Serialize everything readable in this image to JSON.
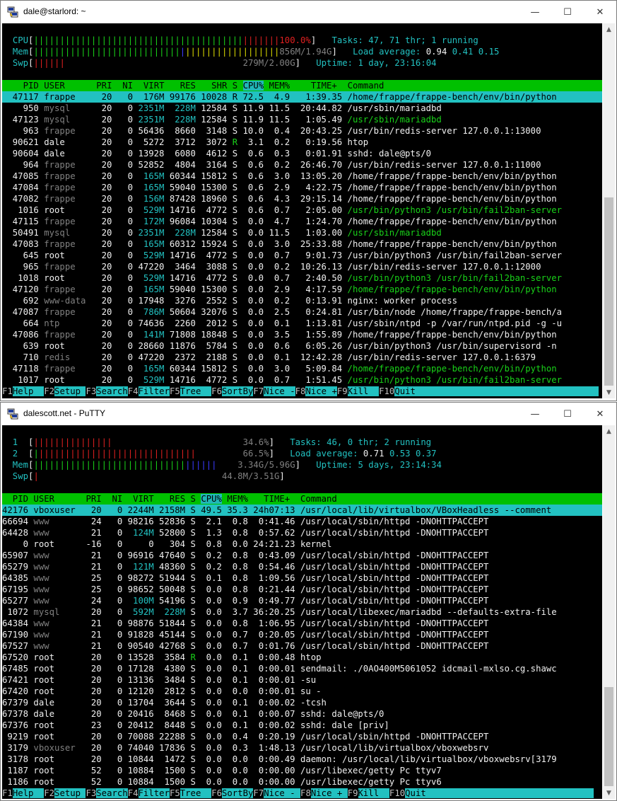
{
  "window1": {
    "title": "dale@starlord: ~",
    "meters": {
      "cpu_label": "CPU",
      "cpu_green": "||||||||||||||||||||||||||||||||||||||||",
      "cpu_red": "|||||||",
      "cpu_value": "100.0%",
      "mem_label": "Mem",
      "mem_green": "||||||||||||||||||||||||||||",
      "mem_blue": "|",
      "mem_yellow": "||||||||||||||||||",
      "mem_value": "856M/1.94G",
      "swp_label": "Swp",
      "swp_red": "||||||",
      "swp_value": "279M/2.00G",
      "tasks_label": "Tasks: ",
      "tasks_value": "47, 71 thr; 1 running",
      "load_label": "Load average: ",
      "load_1": "0.94",
      "load_5": "0.41",
      "load_15": "0.15",
      "uptime_label": "Uptime: ",
      "uptime_value": "1 day, 23:16:04"
    },
    "header": {
      "left": "    PID USER      PRI  NI  VIRT   RES   SHR S ",
      "sorted": "CPU%",
      "right": " MEM%    TIME+  Command"
    },
    "rows": [
      {
        "pid": "47117",
        "user": "frappe",
        "pri": "20",
        "ni": "0",
        "virt": "176M",
        "res": "99176",
        "shr": "10028",
        "s": "R",
        "cpu": "72.5",
        "mem": "4.9",
        "time": "1:39.35",
        "cmd": "/home/frappe/frappe-bench/env/bin/python",
        "selected": true
      },
      {
        "pid": "950",
        "user": "mysql",
        "pri": "20",
        "ni": "0",
        "virt": "2351M",
        "res": "228M",
        "shr": "12584",
        "s": "S",
        "cpu": "11.9",
        "mem": "11.5",
        "time": "20:44.82",
        "cmd": "/usr/sbin/mariadbd"
      },
      {
        "pid": "47123",
        "user": "mysql",
        "pri": "20",
        "ni": "0",
        "virt": "2351M",
        "res": "228M",
        "shr": "12584",
        "s": "S",
        "cpu": "11.9",
        "mem": "11.5",
        "time": "1:05.49",
        "cmd": "/usr/sbin/mariadbd",
        "thread": true
      },
      {
        "pid": "963",
        "user": "frappe",
        "pri": "20",
        "ni": "0",
        "virt": "56436",
        "res": "8660",
        "shr": "3148",
        "s": "S",
        "cpu": "10.0",
        "mem": "0.4",
        "time": "20:43.25",
        "cmd": "/usr/bin/redis-server 127.0.0.1:13000"
      },
      {
        "pid": "90621",
        "user": "dale",
        "pri": "20",
        "ni": "0",
        "virt": "5272",
        "res": "3712",
        "shr": "3072",
        "s": "R",
        "cpu": "3.1",
        "mem": "0.2",
        "time": "0:19.56",
        "cmd": "htop"
      },
      {
        "pid": "90604",
        "user": "dale",
        "pri": "20",
        "ni": "0",
        "virt": "13928",
        "res": "6080",
        "shr": "4612",
        "s": "S",
        "cpu": "0.6",
        "mem": "0.3",
        "time": "0:01.91",
        "cmd": "sshd: dale@pts/0"
      },
      {
        "pid": "964",
        "user": "frappe",
        "pri": "20",
        "ni": "0",
        "virt": "52852",
        "res": "4804",
        "shr": "3164",
        "s": "S",
        "cpu": "0.6",
        "mem": "0.2",
        "time": "26:46.70",
        "cmd": "/usr/bin/redis-server 127.0.0.1:11000"
      },
      {
        "pid": "47085",
        "user": "frappe",
        "pri": "20",
        "ni": "0",
        "virt": "165M",
        "res": "60344",
        "shr": "15812",
        "s": "S",
        "cpu": "0.6",
        "mem": "3.0",
        "time": "13:05.20",
        "cmd": "/home/frappe/frappe-bench/env/bin/python"
      },
      {
        "pid": "47084",
        "user": "frappe",
        "pri": "20",
        "ni": "0",
        "virt": "165M",
        "res": "59040",
        "shr": "15300",
        "s": "S",
        "cpu": "0.6",
        "mem": "2.9",
        "time": "4:22.75",
        "cmd": "/home/frappe/frappe-bench/env/bin/python"
      },
      {
        "pid": "47082",
        "user": "frappe",
        "pri": "20",
        "ni": "0",
        "virt": "156M",
        "res": "87428",
        "shr": "18960",
        "s": "S",
        "cpu": "0.6",
        "mem": "4.3",
        "time": "29:15.14",
        "cmd": "/home/frappe/frappe-bench/env/bin/python"
      },
      {
        "pid": "1016",
        "user": "root",
        "pri": "20",
        "ni": "0",
        "virt": "529M",
        "res": "14716",
        "shr": "4772",
        "s": "S",
        "cpu": "0.6",
        "mem": "0.7",
        "time": "2:05.00",
        "cmd": "/usr/bin/python3 /usr/bin/fail2ban-server",
        "thread": true
      },
      {
        "pid": "47115",
        "user": "frappe",
        "pri": "20",
        "ni": "0",
        "virt": "172M",
        "res": "96084",
        "shr": "10304",
        "s": "S",
        "cpu": "0.0",
        "mem": "4.7",
        "time": "1:24.70",
        "cmd": "/home/frappe/frappe-bench/env/bin/python"
      },
      {
        "pid": "50491",
        "user": "mysql",
        "pri": "20",
        "ni": "0",
        "virt": "2351M",
        "res": "228M",
        "shr": "12584",
        "s": "S",
        "cpu": "0.0",
        "mem": "11.5",
        "time": "1:03.00",
        "cmd": "/usr/sbin/mariadbd",
        "thread": true
      },
      {
        "pid": "47083",
        "user": "frappe",
        "pri": "20",
        "ni": "0",
        "virt": "165M",
        "res": "60312",
        "shr": "15924",
        "s": "S",
        "cpu": "0.0",
        "mem": "3.0",
        "time": "25:33.88",
        "cmd": "/home/frappe/frappe-bench/env/bin/python"
      },
      {
        "pid": "645",
        "user": "root",
        "pri": "20",
        "ni": "0",
        "virt": "529M",
        "res": "14716",
        "shr": "4772",
        "s": "S",
        "cpu": "0.0",
        "mem": "0.7",
        "time": "9:01.73",
        "cmd": "/usr/bin/python3 /usr/bin/fail2ban-server"
      },
      {
        "pid": "965",
        "user": "frappe",
        "pri": "20",
        "ni": "0",
        "virt": "47220",
        "res": "3464",
        "shr": "3088",
        "s": "S",
        "cpu": "0.0",
        "mem": "0.2",
        "time": "10:26.13",
        "cmd": "/usr/bin/redis-server 127.0.0.1:12000"
      },
      {
        "pid": "1018",
        "user": "root",
        "pri": "20",
        "ni": "0",
        "virt": "529M",
        "res": "14716",
        "shr": "4772",
        "s": "S",
        "cpu": "0.0",
        "mem": "0.7",
        "time": "2:40.50",
        "cmd": "/usr/bin/python3 /usr/bin/fail2ban-server",
        "thread": true
      },
      {
        "pid": "47120",
        "user": "frappe",
        "pri": "20",
        "ni": "0",
        "virt": "165M",
        "res": "59040",
        "shr": "15300",
        "s": "S",
        "cpu": "0.0",
        "mem": "2.9",
        "time": "4:17.59",
        "cmd": "/home/frappe/frappe-bench/env/bin/python",
        "thread": true
      },
      {
        "pid": "692",
        "user": "www-data",
        "pri": "20",
        "ni": "0",
        "virt": "17948",
        "res": "3276",
        "shr": "2552",
        "s": "S",
        "cpu": "0.0",
        "mem": "0.2",
        "time": "0:13.91",
        "cmd": "nginx: worker process"
      },
      {
        "pid": "47087",
        "user": "frappe",
        "pri": "20",
        "ni": "0",
        "virt": "786M",
        "res": "50604",
        "shr": "32076",
        "s": "S",
        "cpu": "0.0",
        "mem": "2.5",
        "time": "0:24.81",
        "cmd": "/usr/bin/node /home/frappe/frappe-bench/a"
      },
      {
        "pid": "664",
        "user": "ntp",
        "pri": "20",
        "ni": "0",
        "virt": "74636",
        "res": "2260",
        "shr": "2012",
        "s": "S",
        "cpu": "0.0",
        "mem": "0.1",
        "time": "1:13.81",
        "cmd": "/usr/sbin/ntpd -p /var/run/ntpd.pid -g -u"
      },
      {
        "pid": "47086",
        "user": "frappe",
        "pri": "20",
        "ni": "0",
        "virt": "141M",
        "res": "71808",
        "shr": "18848",
        "s": "S",
        "cpu": "0.0",
        "mem": "3.5",
        "time": "1:55.89",
        "cmd": "/home/frappe/frappe-bench/env/bin/python"
      },
      {
        "pid": "639",
        "user": "root",
        "pri": "20",
        "ni": "0",
        "virt": "28660",
        "res": "11876",
        "shr": "5784",
        "s": "S",
        "cpu": "0.0",
        "mem": "0.6",
        "time": "6:05.26",
        "cmd": "/usr/bin/python3 /usr/bin/supervisord -n"
      },
      {
        "pid": "710",
        "user": "redis",
        "pri": "20",
        "ni": "0",
        "virt": "47220",
        "res": "2372",
        "shr": "2188",
        "s": "S",
        "cpu": "0.0",
        "mem": "0.1",
        "time": "12:42.28",
        "cmd": "/usr/bin/redis-server 127.0.0.1:6379"
      },
      {
        "pid": "47118",
        "user": "frappe",
        "pri": "20",
        "ni": "0",
        "virt": "165M",
        "res": "60344",
        "shr": "15812",
        "s": "S",
        "cpu": "0.0",
        "mem": "3.0",
        "time": "5:09.84",
        "cmd": "/home/frappe/frappe-bench/env/bin/python",
        "thread": true
      },
      {
        "pid": "1017",
        "user": "root",
        "pri": "20",
        "ni": "0",
        "virt": "529M",
        "res": "14716",
        "shr": "4772",
        "s": "S",
        "cpu": "0.0",
        "mem": "0.7",
        "time": "1:51.45",
        "cmd": "/usr/bin/python3 /usr/bin/fail2ban-server",
        "thread": true
      }
    ],
    "fkeys": [
      {
        "key": "F1",
        "label": "Help  "
      },
      {
        "key": "F2",
        "label": "Setup "
      },
      {
        "key": "F3",
        "label": "Search"
      },
      {
        "key": "F4",
        "label": "Filter"
      },
      {
        "key": "F5",
        "label": "Tree  "
      },
      {
        "key": "F6",
        "label": "SortBy"
      },
      {
        "key": "F7",
        "label": "Nice -"
      },
      {
        "key": "F8",
        "label": "Nice +"
      },
      {
        "key": "F9",
        "label": "Kill  "
      },
      {
        "key": "F10",
        "label": "Quit                                   "
      }
    ]
  },
  "window2": {
    "title": "dalescott.net - PuTTY",
    "meters": {
      "cpu1_label": "  1  ",
      "cpu1_red": "|||||||||||||||",
      "cpu1_value": "34.6%",
      "cpu2_label": "  2  ",
      "cpu2_green": "|",
      "cpu2_red": "||||||||||||||||||||||||||||||",
      "cpu2_value": "66.5%",
      "mem_label": "  Mem",
      "mem_green": "|||||||||||||||||||||||||||||",
      "mem_blue": "||||||",
      "mem_value": "3.34G/5.96G",
      "swp_label": "  Swp",
      "swp_red": "|",
      "swp_value": "44.8M/3.51G",
      "tasks_label": "Tasks: ",
      "tasks_value": "46, 0 thr; 2 running",
      "load_label": "Load average: ",
      "load_1": "0.71",
      "load_5": "0.53",
      "load_15": "0.37",
      "uptime_label": "Uptime: ",
      "uptime_value": "5 days, 23:14:34"
    },
    "header": {
      "left": "  PID USER      PRI  NI  VIRT   RES S ",
      "sorted": "CPU%",
      "right": " MEM%   TIME+  Command"
    },
    "rows": [
      {
        "pid": "42176",
        "user": "vboxuser",
        "pri": "20",
        "ni": "0",
        "virt": "2244M",
        "res": "2158M",
        "s": "S",
        "cpu": "49.5",
        "mem": "35.3",
        "time": "24h07:13",
        "cmd": "/usr/local/lib/virtualbox/VBoxHeadless --comment",
        "selected": true
      },
      {
        "pid": "66694",
        "user": "www",
        "pri": "24",
        "ni": "0",
        "virt": "98216",
        "res": "52836",
        "s": "S",
        "cpu": "2.1",
        "mem": "0.8",
        "time": "0:41.46",
        "cmd": "/usr/local/sbin/httpd -DNOHTTPACCEPT"
      },
      {
        "pid": "64428",
        "user": "www",
        "pri": "21",
        "ni": "0",
        "virt": "124M",
        "res": "52800",
        "s": "S",
        "cpu": "1.3",
        "mem": "0.8",
        "time": "0:57.62",
        "cmd": "/usr/local/sbin/httpd -DNOHTTPACCEPT"
      },
      {
        "pid": "0",
        "user": "root",
        "pri": "-16",
        "ni": "0",
        "virt": "0",
        "res": "304",
        "s": "S",
        "cpu": "0.8",
        "mem": "0.0",
        "time": "24:21.23",
        "cmd": "kernel"
      },
      {
        "pid": "65907",
        "user": "www",
        "pri": "21",
        "ni": "0",
        "virt": "96916",
        "res": "47640",
        "s": "S",
        "cpu": "0.2",
        "mem": "0.8",
        "time": "0:43.09",
        "cmd": "/usr/local/sbin/httpd -DNOHTTPACCEPT"
      },
      {
        "pid": "65279",
        "user": "www",
        "pri": "21",
        "ni": "0",
        "virt": "121M",
        "res": "48360",
        "s": "S",
        "cpu": "0.2",
        "mem": "0.8",
        "time": "0:54.46",
        "cmd": "/usr/local/sbin/httpd -DNOHTTPACCEPT"
      },
      {
        "pid": "64385",
        "user": "www",
        "pri": "25",
        "ni": "0",
        "virt": "98272",
        "res": "51944",
        "s": "S",
        "cpu": "0.1",
        "mem": "0.8",
        "time": "1:09.56",
        "cmd": "/usr/local/sbin/httpd -DNOHTTPACCEPT"
      },
      {
        "pid": "67195",
        "user": "www",
        "pri": "25",
        "ni": "0",
        "virt": "98652",
        "res": "50048",
        "s": "S",
        "cpu": "0.0",
        "mem": "0.8",
        "time": "0:21.44",
        "cmd": "/usr/local/sbin/httpd -DNOHTTPACCEPT"
      },
      {
        "pid": "65277",
        "user": "www",
        "pri": "24",
        "ni": "0",
        "virt": "100M",
        "res": "54196",
        "s": "S",
        "cpu": "0.0",
        "mem": "0.9",
        "time": "0:49.77",
        "cmd": "/usr/local/sbin/httpd -DNOHTTPACCEPT"
      },
      {
        "pid": "1072",
        "user": "mysql",
        "pri": "20",
        "ni": "0",
        "virt": "592M",
        "res": "228M",
        "s": "S",
        "cpu": "0.0",
        "mem": "3.7",
        "time": "36:20.25",
        "cmd": "/usr/local/libexec/mariadbd --defaults-extra-file"
      },
      {
        "pid": "64384",
        "user": "www",
        "pri": "21",
        "ni": "0",
        "virt": "98876",
        "res": "51844",
        "s": "S",
        "cpu": "0.0",
        "mem": "0.8",
        "time": "1:06.95",
        "cmd": "/usr/local/sbin/httpd -DNOHTTPACCEPT"
      },
      {
        "pid": "67190",
        "user": "www",
        "pri": "21",
        "ni": "0",
        "virt": "91828",
        "res": "45144",
        "s": "S",
        "cpu": "0.0",
        "mem": "0.7",
        "time": "0:20.05",
        "cmd": "/usr/local/sbin/httpd -DNOHTTPACCEPT"
      },
      {
        "pid": "67527",
        "user": "www",
        "pri": "21",
        "ni": "0",
        "virt": "90540",
        "res": "42768",
        "s": "S",
        "cpu": "0.0",
        "mem": "0.7",
        "time": "0:01.76",
        "cmd": "/usr/local/sbin/httpd -DNOHTTPACCEPT"
      },
      {
        "pid": "67520",
        "user": "root",
        "pri": "20",
        "ni": "0",
        "virt": "13528",
        "res": "3584",
        "s": "R",
        "cpu": "0.0",
        "mem": "0.1",
        "time": "0:00.48",
        "cmd": "htop"
      },
      {
        "pid": "67485",
        "user": "root",
        "pri": "20",
        "ni": "0",
        "virt": "17128",
        "res": "4380",
        "s": "S",
        "cpu": "0.0",
        "mem": "0.1",
        "time": "0:00.01",
        "cmd": "sendmail: ./0AO400M5061052 idcmail-mxlso.cg.shawc"
      },
      {
        "pid": "67421",
        "user": "root",
        "pri": "20",
        "ni": "0",
        "virt": "13136",
        "res": "3484",
        "s": "S",
        "cpu": "0.0",
        "mem": "0.1",
        "time": "0:00.01",
        "cmd": "-su"
      },
      {
        "pid": "67420",
        "user": "root",
        "pri": "20",
        "ni": "0",
        "virt": "12120",
        "res": "2812",
        "s": "S",
        "cpu": "0.0",
        "mem": "0.0",
        "time": "0:00.01",
        "cmd": "su -"
      },
      {
        "pid": "67379",
        "user": "dale",
        "pri": "20",
        "ni": "0",
        "virt": "13704",
        "res": "3644",
        "s": "S",
        "cpu": "0.0",
        "mem": "0.1",
        "time": "0:00.02",
        "cmd": "-tcsh"
      },
      {
        "pid": "67378",
        "user": "dale",
        "pri": "20",
        "ni": "0",
        "virt": "20416",
        "res": "8468",
        "s": "S",
        "cpu": "0.0",
        "mem": "0.1",
        "time": "0:00.07",
        "cmd": "sshd: dale@pts/0"
      },
      {
        "pid": "67376",
        "user": "root",
        "pri": "23",
        "ni": "0",
        "virt": "20412",
        "res": "8448",
        "s": "S",
        "cpu": "0.0",
        "mem": "0.1",
        "time": "0:00.02",
        "cmd": "sshd: dale [priv]"
      },
      {
        "pid": "9219",
        "user": "root",
        "pri": "20",
        "ni": "0",
        "virt": "70088",
        "res": "22288",
        "s": "S",
        "cpu": "0.0",
        "mem": "0.4",
        "time": "0:20.19",
        "cmd": "/usr/local/sbin/httpd -DNOHTTPACCEPT"
      },
      {
        "pid": "3179",
        "user": "vboxuser",
        "pri": "20",
        "ni": "0",
        "virt": "74040",
        "res": "17836",
        "s": "S",
        "cpu": "0.0",
        "mem": "0.3",
        "time": "1:48.13",
        "cmd": "/usr/local/lib/virtualbox/vboxwebsrv"
      },
      {
        "pid": "3178",
        "user": "root",
        "pri": "20",
        "ni": "0",
        "virt": "10844",
        "res": "1472",
        "s": "S",
        "cpu": "0.0",
        "mem": "0.0",
        "time": "0:00.49",
        "cmd": "daemon: /usr/local/lib/virtualbox/vboxwebsrv[3179"
      },
      {
        "pid": "1187",
        "user": "root",
        "pri": "52",
        "ni": "0",
        "virt": "10884",
        "res": "1500",
        "s": "S",
        "cpu": "0.0",
        "mem": "0.0",
        "time": "0:00.00",
        "cmd": "/usr/libexec/getty Pc ttyv7"
      },
      {
        "pid": "1186",
        "user": "root",
        "pri": "52",
        "ni": "0",
        "virt": "10884",
        "res": "1500",
        "s": "S",
        "cpu": "0.0",
        "mem": "0.0",
        "time": "0:00.00",
        "cmd": "/usr/libexec/getty Pc ttyv6"
      }
    ],
    "fkeys": [
      {
        "key": "F1",
        "label": "Help  "
      },
      {
        "key": "F2",
        "label": "Setup "
      },
      {
        "key": "F3",
        "label": "Search"
      },
      {
        "key": "F4",
        "label": "Filter"
      },
      {
        "key": "F5",
        "label": "Tree  "
      },
      {
        "key": "F6",
        "label": "SortBy"
      },
      {
        "key": "F7",
        "label": "Nice - "
      },
      {
        "key": "F8",
        "label": "Nice + "
      },
      {
        "key": "F9",
        "label": "Kill  "
      },
      {
        "key": "F10",
        "label": "Quit                                "
      }
    ]
  },
  "window_controls": {
    "minimize": "—",
    "maximize": "☐",
    "close": "✕"
  },
  "scroll": {
    "up": "▲",
    "down": "▼"
  },
  "colors": {
    "cyan": "#22c1c1",
    "green": "#19d219",
    "header": "#00c000",
    "terminal_bg": "#000000"
  }
}
